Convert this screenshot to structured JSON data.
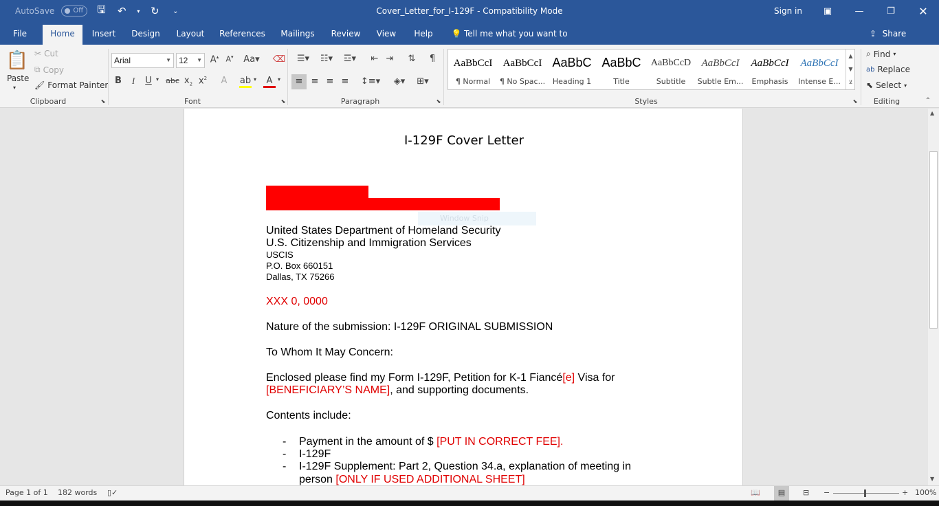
{
  "titlebar": {
    "autosave_label": "AutoSave",
    "autosave_state": "Off",
    "doc_title": "Cover_Letter_for_I-129F  -  Compatibility Mode",
    "signin": "Sign in"
  },
  "tabs": [
    "File",
    "Home",
    "Insert",
    "Design",
    "Layout",
    "References",
    "Mailings",
    "Review",
    "View",
    "Help"
  ],
  "tell_me": "Tell me what you want to do",
  "share": "Share",
  "clipboard": {
    "paste": "Paste",
    "cut": "Cut",
    "copy": "Copy",
    "format_painter": "Format Painter",
    "label": "Clipboard"
  },
  "font": {
    "name": "Arial",
    "size": "12",
    "label": "Font"
  },
  "paragraph": {
    "label": "Paragraph"
  },
  "styles": {
    "items": [
      {
        "preview": "AaBbCcI",
        "name": "¶ Normal"
      },
      {
        "preview": "AaBbCcI",
        "name": "¶ No Spac..."
      },
      {
        "preview": "AaBbC",
        "name": "Heading 1"
      },
      {
        "preview": "AaBbC",
        "name": "Title"
      },
      {
        "preview": "AaBbCcD",
        "name": "Subtitle"
      },
      {
        "preview": "AaBbCcI",
        "name": "Subtle Em..."
      },
      {
        "preview": "AaBbCcI",
        "name": "Emphasis"
      },
      {
        "preview": "AaBbCcI",
        "name": "Intense E..."
      }
    ],
    "label": "Styles"
  },
  "editing": {
    "find": "Find",
    "replace": "Replace",
    "select": "Select",
    "label": "Editing"
  },
  "document": {
    "heading": "I-129F Cover Letter",
    "overlay": "Window Snip",
    "addr1": "United States Department of Homeland Security",
    "addr2": "U.S. Citizenship and Immigration Services",
    "addr3": "USCIS",
    "addr4": "P.O. Box 660151",
    "addr5": "Dallas, TX 75266",
    "date": "XXX 0, 0000",
    "nature": "Nature of the submission: I-129F ORIGINAL SUBMISSION",
    "greeting": "To Whom It May Concern:",
    "encl_a": "Enclosed please find my Form I-129F, Petition for K-1 Fiancé",
    "encl_b": "[e]",
    "encl_c": " Visa for",
    "encl_d": "[BENEFICIARY’S NAME]",
    "encl_e": ", and supporting documents.",
    "contents": "Contents include:",
    "bullet": "-",
    "b1a": "Payment in the amount of $ ",
    "b1b": "[PUT IN CORRECT FEE]",
    "b1c": ".",
    "b2": " I-129F",
    "b3a": "I-129F Supplement: Part 2, Question 34.a, explanation of meeting in",
    "b3b": "person ",
    "b3c": "[ONLY IF USED ADDITIONAL SHEET]"
  },
  "status": {
    "page": "Page 1 of 1",
    "words": "182 words",
    "zoom": "100%"
  }
}
